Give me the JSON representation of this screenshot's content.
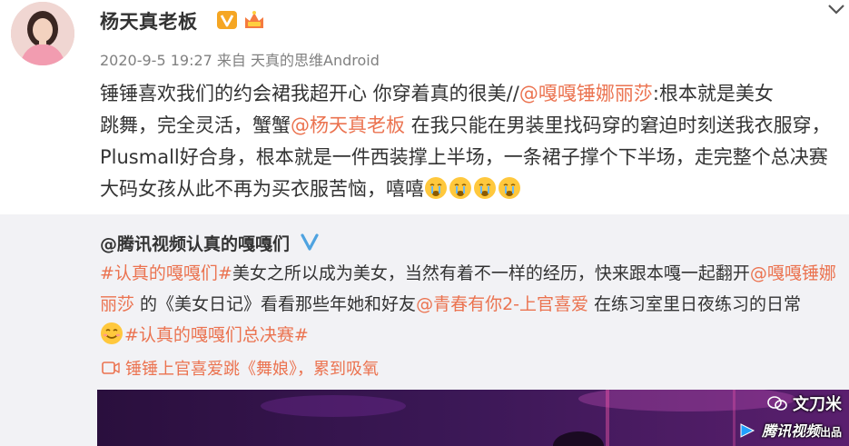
{
  "user": {
    "name": "杨天真老板",
    "timestamp": "2020-9-5 19:27",
    "source_prefix": "来自",
    "source": "天真的思维Android"
  },
  "post": {
    "line1_a": "锤锤喜欢我们的约会裙我超开心 你穿着真的很美//",
    "mention1": "@嘎嘎锤娜丽莎",
    "line1_b": ":根本就是美女",
    "line2_a": "跳舞，完全灵活，蟹蟹",
    "mention2": "@杨天真老板",
    "line2_b": " 在我只能在男装里找码穿的窘迫时刻送我衣服穿，Plusmall好合身，根本就是一件西装撑上半场，一条裙子撑个下半场，走完整个总决赛大码女孩从此不再为买衣服苦恼，嘻嘻"
  },
  "repost": {
    "author": "@腾讯视频认真的嘎嘎们",
    "hashtag1": "#认真的嘎嘎们#",
    "text_a": "美女之所以成为美女，当然有着不一样的经历，快来跟本嘎一起翻开",
    "mention3": "@嘎嘎锤娜丽莎",
    "text_b": " 的《美女日记》看看那些年她和好友",
    "mention4": "@青春有你2-上官喜爱",
    "text_c": " 在练习室里日夜练习的日常",
    "hashtag2": "#认真的嘎嘎们总决赛#",
    "video_link": "锤锤上官喜爱跳《舞娘》，累到吸氧"
  },
  "watermarks": {
    "wechat": "文刀米",
    "tencent": "腾讯视频",
    "tencent_suffix": "出品"
  },
  "colors": {
    "link": "#eb7350",
    "repost_bg": "#f2f2f5",
    "verify_gold": "#f5a623",
    "verify_blue": "#4fa3e0"
  }
}
